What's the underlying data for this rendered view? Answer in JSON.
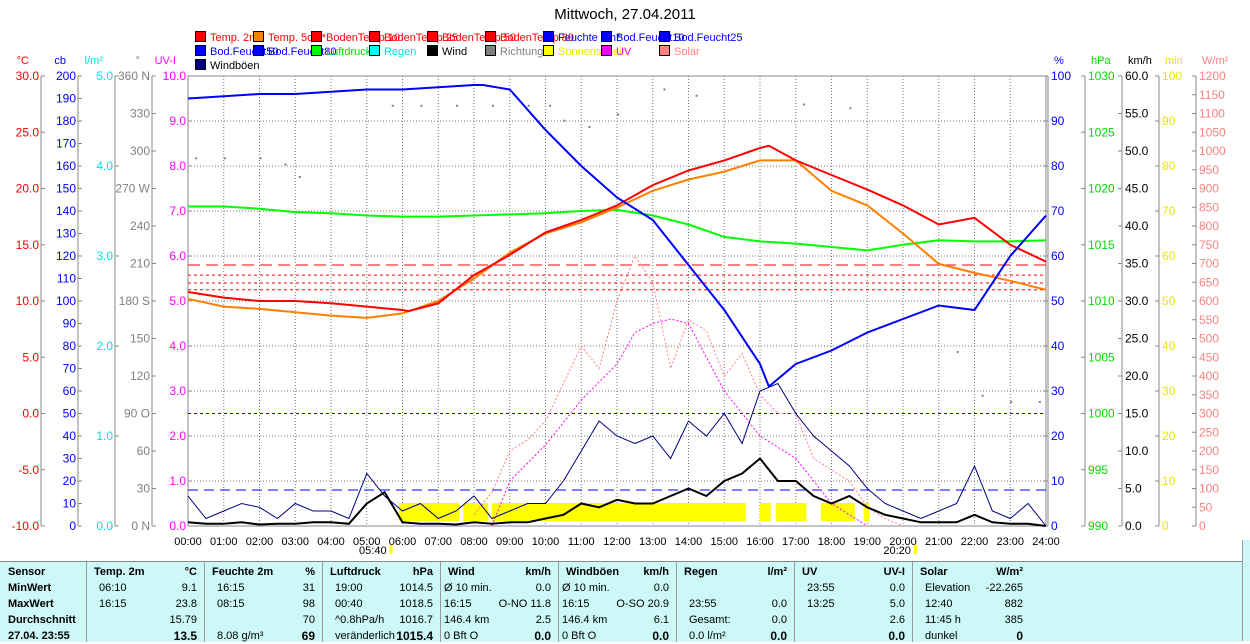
{
  "title": "Mittwoch, 27.04.2011",
  "legend": [
    {
      "label": "Temp. 2m",
      "color": "#ff0000",
      "text": "#ff0000"
    },
    {
      "label": "Temp. 5cm*",
      "color": "#ff8000",
      "text": "#ff0000"
    },
    {
      "label": "BodenTemp 10",
      "color": "#ff0000",
      "text": "#ff0000"
    },
    {
      "label": "BodenTemp 25",
      "color": "#ff0000",
      "text": "#ff0000"
    },
    {
      "label": "BodenTemp 50",
      "color": "#ff0000",
      "text": "#ff0000"
    },
    {
      "label": "BodenTemp 80",
      "color": "#ff0000",
      "text": "#ff0000"
    },
    {
      "label": "Feuchte 2m*",
      "color": "#0000ff",
      "text": "#0000ff"
    },
    {
      "label": "Bod.Feucht10",
      "color": "#0000ff",
      "text": "#0000ff"
    },
    {
      "label": "Bod.Feucht25",
      "color": "#0000ff",
      "text": "#0000ff"
    },
    {
      "label": "Bod.Feucht50",
      "color": "#0000ff",
      "text": "#0000ff"
    },
    {
      "label": "Bod.Feucht80",
      "color": "#0000ff",
      "text": "#0000ff"
    },
    {
      "label": "Luftdruck",
      "color": "#00ff00",
      "text": "#00dd00"
    },
    {
      "label": "Regen",
      "color": "#00ffff",
      "text": "#00e0e0"
    },
    {
      "label": "Wind",
      "color": "#000000",
      "text": "#000000"
    },
    {
      "label": "Richtung",
      "color": "#808080",
      "text": "#808080"
    },
    {
      "label": "Sonnenschein",
      "color": "#ffff00",
      "text": "#e8e800"
    },
    {
      "label": "UV",
      "color": "#ff00ff",
      "text": "#ff00ff"
    },
    {
      "label": "Solar",
      "color": "#ff8080",
      "text": "#ff8080"
    },
    {
      "label": "Windböen",
      "color": "#000080",
      "text": "#000000"
    }
  ],
  "chart_data": {
    "type": "line",
    "title": "Mittwoch, 27.04.2011",
    "x_ticks": [
      "00:00",
      "01:00",
      "02:00",
      "03:00",
      "04:00",
      "05:00",
      "06:00",
      "07:00",
      "08:00",
      "09:00",
      "10:00",
      "11:00",
      "12:00",
      "13:00",
      "14:00",
      "15:00",
      "16:00",
      "17:00",
      "18:00",
      "19:00",
      "20:00",
      "21:00",
      "22:00",
      "23:00",
      "24:00"
    ],
    "sunrise": "05:40",
    "sunset": "20:20",
    "axes": {
      "left": [
        {
          "unit": "°C",
          "color": "#ff0000",
          "min": -10,
          "max": 30,
          "ticks": [
            "-10.0",
            "-5.0",
            "0.0",
            "5.0",
            "10.0",
            "15.0",
            "20.0",
            "25.0",
            "30.0"
          ]
        },
        {
          "unit": "cb",
          "color": "#0000ff",
          "min": 0,
          "max": 200,
          "ticks": [
            "0",
            "10",
            "20",
            "30",
            "40",
            "50",
            "60",
            "70",
            "80",
            "90",
            "100",
            "110",
            "120",
            "130",
            "140",
            "150",
            "160",
            "170",
            "180",
            "190",
            "200"
          ]
        },
        {
          "unit": "l/m²",
          "color": "#00e0e0",
          "min": 0,
          "max": 5,
          "ticks": [
            "0.0",
            "1.0",
            "2.0",
            "3.0",
            "4.0",
            "5.0"
          ]
        },
        {
          "unit": "°",
          "color": "#808080",
          "min": 0,
          "max": 360,
          "ticks": [
            "0 N",
            "30",
            "60",
            "90 O",
            "120",
            "150",
            "180 S",
            "210",
            "240",
            "270 W",
            "300",
            "330",
            "360 N"
          ]
        },
        {
          "unit": "UV-I",
          "color": "#ff00ff",
          "min": 0,
          "max": 10,
          "ticks": [
            "0.0",
            "1.0",
            "2.0",
            "3.0",
            "4.0",
            "5.0",
            "6.0",
            "7.0",
            "8.0",
            "9.0",
            "10.0"
          ]
        }
      ],
      "right": [
        {
          "unit": "%",
          "color": "#0000ff",
          "min": 0,
          "max": 100,
          "ticks": [
            "0",
            "10",
            "20",
            "30",
            "40",
            "50",
            "60",
            "70",
            "80",
            "90",
            "100"
          ]
        },
        {
          "unit": "hPa",
          "color": "#00dd00",
          "min": 990,
          "max": 1030,
          "ticks": [
            "990",
            "995",
            "1000",
            "1005",
            "1010",
            "1015",
            "1020",
            "1025",
            "1030"
          ]
        },
        {
          "unit": "km/h",
          "color": "#000000",
          "min": 0,
          "max": 60,
          "ticks": [
            "0.0",
            "5.0",
            "10.0",
            "15.0",
            "20.0",
            "25.0",
            "30.0",
            "35.0",
            "40.0",
            "45.0",
            "50.0",
            "55.0",
            "60.0"
          ]
        },
        {
          "unit": "min",
          "color": "#e8e800",
          "min": 0,
          "max": 100,
          "ticks": [
            "0",
            "10",
            "20",
            "30",
            "40",
            "50",
            "60",
            "70",
            "80",
            "90",
            "100"
          ]
        },
        {
          "unit": "W/m²",
          "color": "#ff8080",
          "min": 0,
          "max": 1200,
          "ticks": [
            "0",
            "50",
            "100",
            "150",
            "200",
            "250",
            "300",
            "350",
            "400",
            "450",
            "500",
            "550",
            "600",
            "650",
            "700",
            "750",
            "800",
            "850",
            "900",
            "950",
            "1000",
            "1050",
            "1100",
            "1150",
            "1200"
          ]
        }
      ]
    },
    "series": [
      {
        "name": "Solar",
        "axis": "W/m²",
        "color": "#ff8080",
        "dash": "2,2",
        "x": [
          8,
          8.5,
          9,
          9.5,
          10,
          10.5,
          11,
          11.5,
          12,
          12.5,
          13,
          13.5,
          14,
          14.5,
          15,
          15.5,
          16,
          16.5,
          17,
          17.5,
          18,
          18.5,
          19,
          19.5,
          20
        ],
        "values": [
          30,
          90,
          200,
          230,
          280,
          380,
          480,
          420,
          600,
          720,
          650,
          420,
          550,
          520,
          400,
          460,
          350,
          300,
          300,
          180,
          150,
          120,
          50,
          20,
          0
        ]
      },
      {
        "name": "UV",
        "axis": "UV-I",
        "color": "#ff00ff",
        "dash": "2,2",
        "x": [
          8.5,
          9,
          10,
          11,
          12,
          12.5,
          13,
          13.5,
          14,
          15,
          16,
          17,
          18,
          19
        ],
        "values": [
          0,
          1,
          1.8,
          2.8,
          3.6,
          4.3,
          4.5,
          4.6,
          4.5,
          3,
          2,
          1.5,
          0.5,
          0
        ]
      },
      {
        "name": "Luftdruck",
        "axis": "hPa",
        "color": "#00ff00",
        "x": [
          0,
          1,
          2,
          3,
          4,
          5,
          6,
          7,
          8,
          9,
          10,
          11,
          12,
          13,
          14,
          15,
          16,
          17,
          18,
          19,
          20,
          21,
          22,
          23,
          24
        ],
        "values": [
          1018.4,
          1018.4,
          1018.2,
          1017.9,
          1017.8,
          1017.6,
          1017.5,
          1017.5,
          1017.6,
          1017.7,
          1017.8,
          1018.0,
          1018.1,
          1017.6,
          1016.8,
          1015.7,
          1015.3,
          1015.1,
          1014.8,
          1014.5,
          1015.0,
          1015.4,
          1015.3,
          1015.3,
          1015.4
        ]
      },
      {
        "name": "Temp. 5cm*",
        "axis": "°C",
        "color": "#ff8000",
        "x": [
          0,
          1,
          2,
          3,
          4,
          5,
          6,
          7,
          8,
          9,
          10,
          11,
          12,
          13,
          14,
          15,
          16,
          17,
          18,
          19,
          20,
          21,
          22,
          23,
          24
        ],
        "values": [
          10.2,
          9.5,
          9.3,
          9.0,
          8.7,
          8.5,
          8.9,
          10.0,
          12.0,
          14.3,
          16.0,
          17.0,
          18.3,
          19.8,
          20.8,
          21.5,
          22.5,
          22.5,
          19.8,
          18.5,
          16.0,
          13.3,
          12.5,
          11.8,
          11.0
        ]
      },
      {
        "name": "Temp. 2m",
        "axis": "°C",
        "color": "#ff0000",
        "x": [
          0,
          1,
          2,
          3,
          4,
          5,
          6,
          6.17,
          7,
          8,
          9,
          10,
          11,
          12,
          13,
          14,
          15,
          16,
          16.25,
          17,
          18,
          19,
          20,
          21,
          22,
          23,
          24
        ],
        "values": [
          10.8,
          10.3,
          10.0,
          10.0,
          9.8,
          9.5,
          9.2,
          9.1,
          9.8,
          12.3,
          14.1,
          16.1,
          17.2,
          18.5,
          20.3,
          21.6,
          22.5,
          23.6,
          23.8,
          22.5,
          21.2,
          19.9,
          18.5,
          16.8,
          17.4,
          15.0,
          13.5
        ]
      },
      {
        "name": "Feuchte 2m*",
        "axis": "%",
        "color": "#0000ff",
        "x": [
          0,
          1,
          2,
          3,
          4,
          5,
          6,
          7,
          8,
          8.25,
          9,
          10,
          11,
          12,
          13,
          14,
          15,
          16,
          16.25,
          17,
          18,
          19,
          20,
          21,
          22,
          23,
          24
        ],
        "values": [
          95,
          95.5,
          96,
          96,
          96.5,
          97,
          97,
          97.5,
          98,
          98,
          97,
          88,
          80,
          73,
          68,
          58,
          48,
          36,
          31,
          36,
          39,
          43,
          46,
          49,
          48,
          60,
          69
        ]
      },
      {
        "name": "Windböen",
        "axis": "km/h",
        "color": "#000080",
        "x": [
          0,
          0.5,
          1,
          1.5,
          2,
          2.5,
          3,
          3.5,
          4,
          4.5,
          5,
          5.5,
          6,
          6.5,
          7,
          7.5,
          8,
          8.5,
          9,
          9.5,
          10,
          10.5,
          11,
          11.5,
          12,
          12.5,
          13,
          13.5,
          14,
          14.5,
          15,
          15.5,
          16,
          16.5,
          17,
          17.5,
          18,
          18.5,
          19,
          19.5,
          20,
          20.5,
          21,
          21.5,
          22,
          22.5,
          23,
          23.5,
          24
        ],
        "values": [
          4,
          1,
          2,
          3,
          2.5,
          1,
          3,
          2,
          2,
          1,
          7,
          4,
          2,
          3,
          1,
          2,
          4,
          1,
          2,
          3,
          3,
          6,
          10,
          14,
          12,
          11,
          12,
          9,
          14,
          12,
          15,
          11,
          18,
          19,
          15,
          12,
          10,
          8,
          5,
          3,
          2,
          1,
          2,
          3,
          8,
          2,
          1,
          3,
          0
        ]
      },
      {
        "name": "Wind",
        "axis": "km/h",
        "color": "#000000",
        "x": [
          0,
          0.5,
          1,
          1.5,
          2,
          2.5,
          3,
          3.5,
          4,
          4.5,
          5,
          5.5,
          6,
          6.5,
          7,
          7.5,
          8,
          8.5,
          9,
          9.5,
          10,
          10.5,
          11,
          11.5,
          12,
          12.5,
          13,
          13.5,
          14,
          14.5,
          15,
          15.5,
          16,
          16.5,
          17,
          17.5,
          18,
          18.5,
          19,
          19.5,
          20,
          20.5,
          21,
          21.5,
          22,
          22.5,
          23,
          23.5,
          24
        ],
        "values": [
          0.5,
          0.3,
          0.3,
          0.5,
          0.2,
          0.3,
          0.3,
          0.5,
          0.5,
          0.3,
          3,
          4.5,
          0.5,
          0.3,
          0.3,
          0.2,
          0.5,
          0.3,
          0.5,
          0.5,
          1,
          1.5,
          3,
          2.5,
          3.5,
          3,
          3,
          4,
          5,
          4,
          6,
          7,
          9,
          6,
          6,
          4,
          3,
          4,
          2.5,
          1.5,
          1,
          0.5,
          0.5,
          0.5,
          1.5,
          0.5,
          0.3,
          0.3,
          0
        ]
      }
    ],
    "reference_lines": [
      {
        "name": "BodenTemp 10",
        "axis": "°C",
        "color": "#ff0000",
        "value": 13.2,
        "dash": "12,6"
      },
      {
        "name": "BodenTemp 25",
        "axis": "°C",
        "color": "#ff0000",
        "value": 12.3,
        "dash": "3,3"
      },
      {
        "name": "BodenTemp 50",
        "axis": "°C",
        "color": "#ff0000",
        "value": 11.6,
        "dash": "3,3"
      },
      {
        "name": "BodenTemp 80",
        "axis": "°C",
        "color": "#ff0000",
        "value": 11.0,
        "dash": "3,3"
      },
      {
        "name": "Bod.Feucht",
        "axis": "cb",
        "color": "#0000ff",
        "value": 50,
        "dash": "3,3"
      },
      {
        "name": "Windböen Ø",
        "axis": "km/h",
        "color": "#0000ff",
        "value": 4.8,
        "dash": "10,6"
      }
    ],
    "direction_points": [
      [
        0.2,
        295
      ],
      [
        1,
        295
      ],
      [
        2,
        295
      ],
      [
        2.7,
        290
      ],
      [
        3.1,
        280
      ],
      [
        5.7,
        337
      ],
      [
        6.5,
        337
      ],
      [
        7.5,
        337
      ],
      [
        8.5,
        337
      ],
      [
        9.5,
        337
      ],
      [
        10.1,
        337
      ],
      [
        10.5,
        325
      ],
      [
        11.2,
        320
      ],
      [
        12,
        330
      ],
      [
        13.3,
        350
      ],
      [
        14.2,
        345
      ],
      [
        17.2,
        338
      ],
      [
        18.5,
        335
      ],
      [
        21.5,
        140
      ],
      [
        22.2,
        105
      ],
      [
        23,
        100
      ],
      [
        23.8,
        100
      ]
    ],
    "sunshine_segments": [
      [
        5.9,
        7.6
      ],
      [
        7.7,
        8.4
      ],
      [
        8.5,
        15.6
      ],
      [
        16.0,
        16.3
      ],
      [
        16.45,
        17.3
      ],
      [
        17.7,
        18.65
      ],
      [
        18.9,
        19.05
      ]
    ]
  },
  "table": {
    "row_labels": [
      "Sensor",
      "MinWert",
      "MaxWert",
      "Durchschnitt",
      "27.04. 23:55"
    ],
    "columns": [
      {
        "title": "Temp. 2m",
        "unit": "°C",
        "rows": [
          [
            "06:10",
            "9.1"
          ],
          [
            "16:15",
            "23.8"
          ],
          [
            "",
            "15.79"
          ],
          [
            "",
            "13.5"
          ]
        ]
      },
      {
        "title": "Feuchte 2m",
        "unit": "%",
        "rows": [
          [
            "16:15",
            "31"
          ],
          [
            "08:15",
            "98"
          ],
          [
            "",
            "70"
          ],
          [
            "8.08 g/m³",
            "69"
          ]
        ]
      },
      {
        "title": "Luftdruck",
        "unit": "hPa",
        "rows": [
          [
            "19:00",
            "1014.5"
          ],
          [
            "00:40",
            "1018.5"
          ],
          [
            "^0.8hPa/h",
            "1016.7"
          ],
          [
            "veränderlich",
            "1015.4"
          ]
        ]
      },
      {
        "title": "Wind",
        "unit": "km/h",
        "rows": [
          [
            "Ø 10 min.",
            "0.0"
          ],
          [
            "16:15",
            "O-NO 11.8"
          ],
          [
            "146.4 km",
            "2.5"
          ],
          [
            "0 Bft O",
            "0.0"
          ]
        ]
      },
      {
        "title": "Windböen",
        "unit": "km/h",
        "rows": [
          [
            "Ø 10 min.",
            "0.0"
          ],
          [
            "16:15",
            "O-SO 20.9"
          ],
          [
            "146.4 km",
            "6.1"
          ],
          [
            "0 Bft O",
            "0.0"
          ]
        ]
      },
      {
        "title": "Regen",
        "unit": "l/m²",
        "rows": [
          [
            "",
            ""
          ],
          [
            "23:55",
            "0.0"
          ],
          [
            "Gesamt:",
            "0.0"
          ],
          [
            "0.0 l/m²",
            "0.0"
          ]
        ]
      },
      {
        "title": "UV",
        "unit": "UV-I",
        "rows": [
          [
            "23:55",
            "0.0"
          ],
          [
            "13:25",
            "5.0"
          ],
          [
            "",
            "2.6"
          ],
          [
            "",
            "0.0"
          ]
        ]
      },
      {
        "title": "Solar",
        "unit": "W/m²",
        "rows": [
          [
            "Elevation",
            "-22.265"
          ],
          [
            "12:40",
            "882"
          ],
          [
            "11:45 h",
            "385"
          ],
          [
            "dunkel",
            "0"
          ]
        ]
      }
    ]
  }
}
